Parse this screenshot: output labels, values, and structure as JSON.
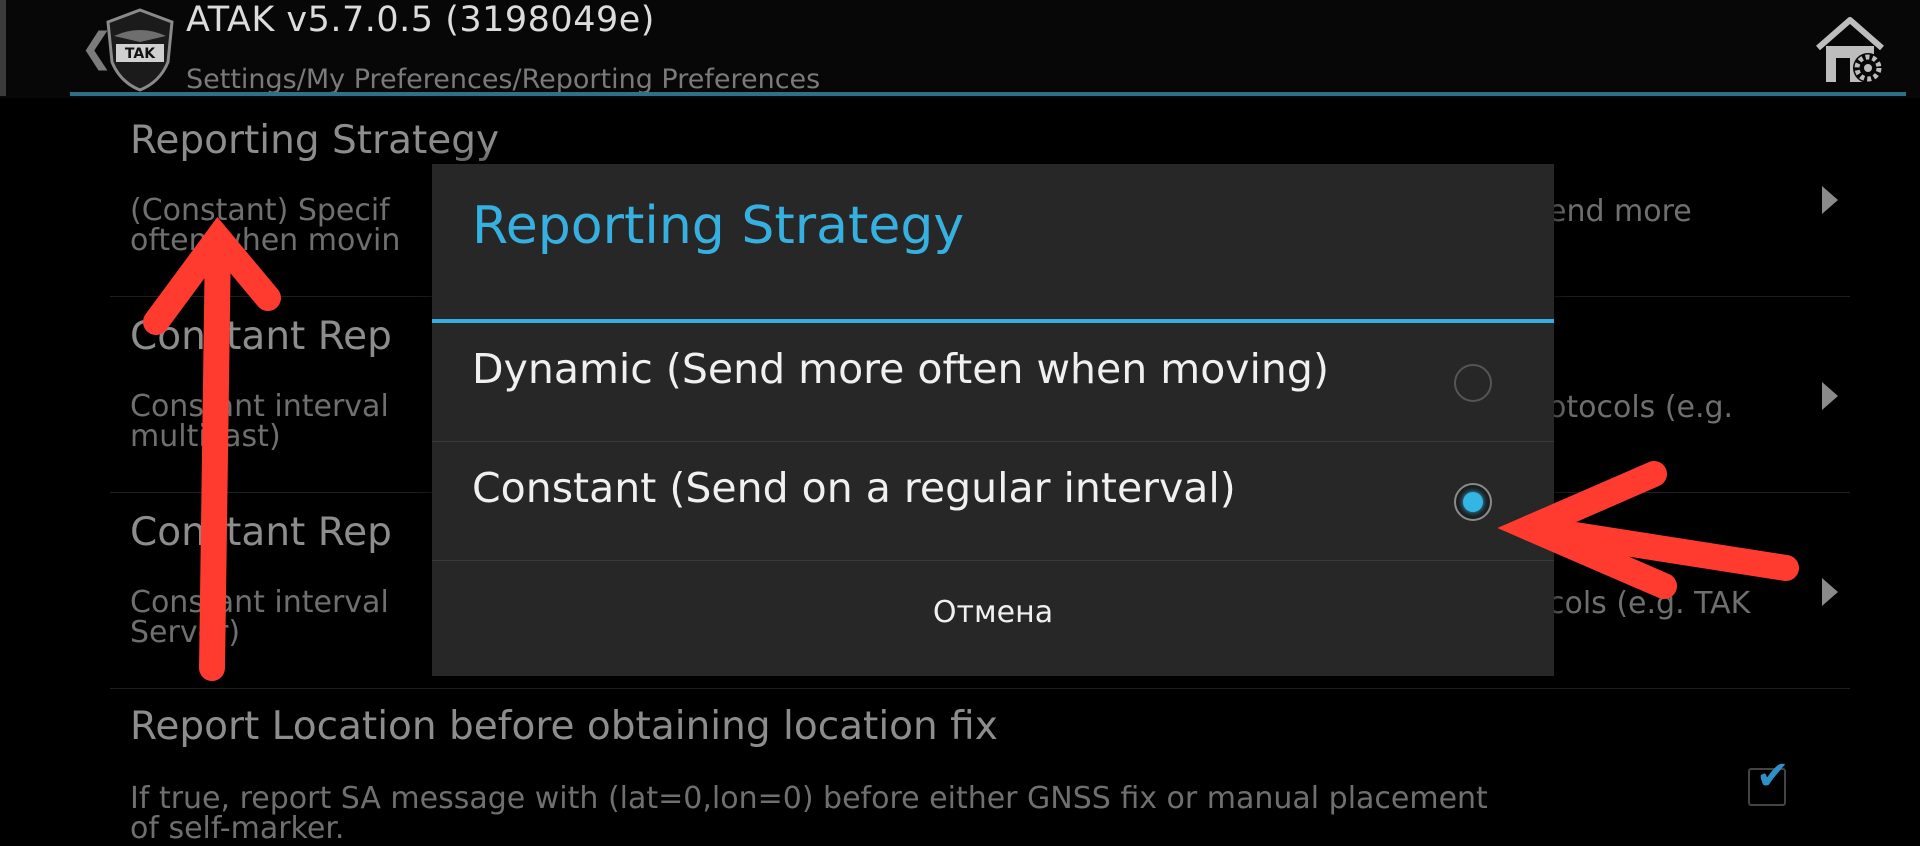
{
  "header": {
    "back_glyph": "❮",
    "logo_icon": "tak-shield-logo-icon",
    "logo_text": "TAK",
    "title": "ATAK v5.7.0.5 (3198049e)",
    "breadcrumb": "Settings/My Preferences/Reporting Preferences",
    "home_settings_icon": "home-settings-icon"
  },
  "preferences": [
    {
      "title": "Reporting Strategy",
      "desc_line1": "(Constant) Specif",
      "desc_line2": "often when movin",
      "desc_right": "end more"
    },
    {
      "title": "Constant Rep",
      "desc_line1": "Constant interval",
      "desc_line2": "multicast)",
      "desc_right": "otocols (e.g."
    },
    {
      "title": "Constant Rep",
      "desc_line1": "Constant interval",
      "desc_line2": "Server)",
      "desc_right": "cols (e.g. TAK"
    },
    {
      "title": "Report Location before obtaining location fix",
      "desc_line1": "If true, report SA message with (lat=0,lon=0) before either GNSS fix or manual placement",
      "desc_line2": "of self-marker.",
      "checked": true
    }
  ],
  "dialog": {
    "title": "Reporting Strategy",
    "options": [
      {
        "label": "Dynamic (Send more often when moving)",
        "selected": false
      },
      {
        "label": "Constant (Send on a regular interval)",
        "selected": true
      }
    ],
    "cancel_label": "Отмена"
  },
  "colors": {
    "accent": "#33b5e5",
    "annotation_arrow": "#ff3b30"
  }
}
